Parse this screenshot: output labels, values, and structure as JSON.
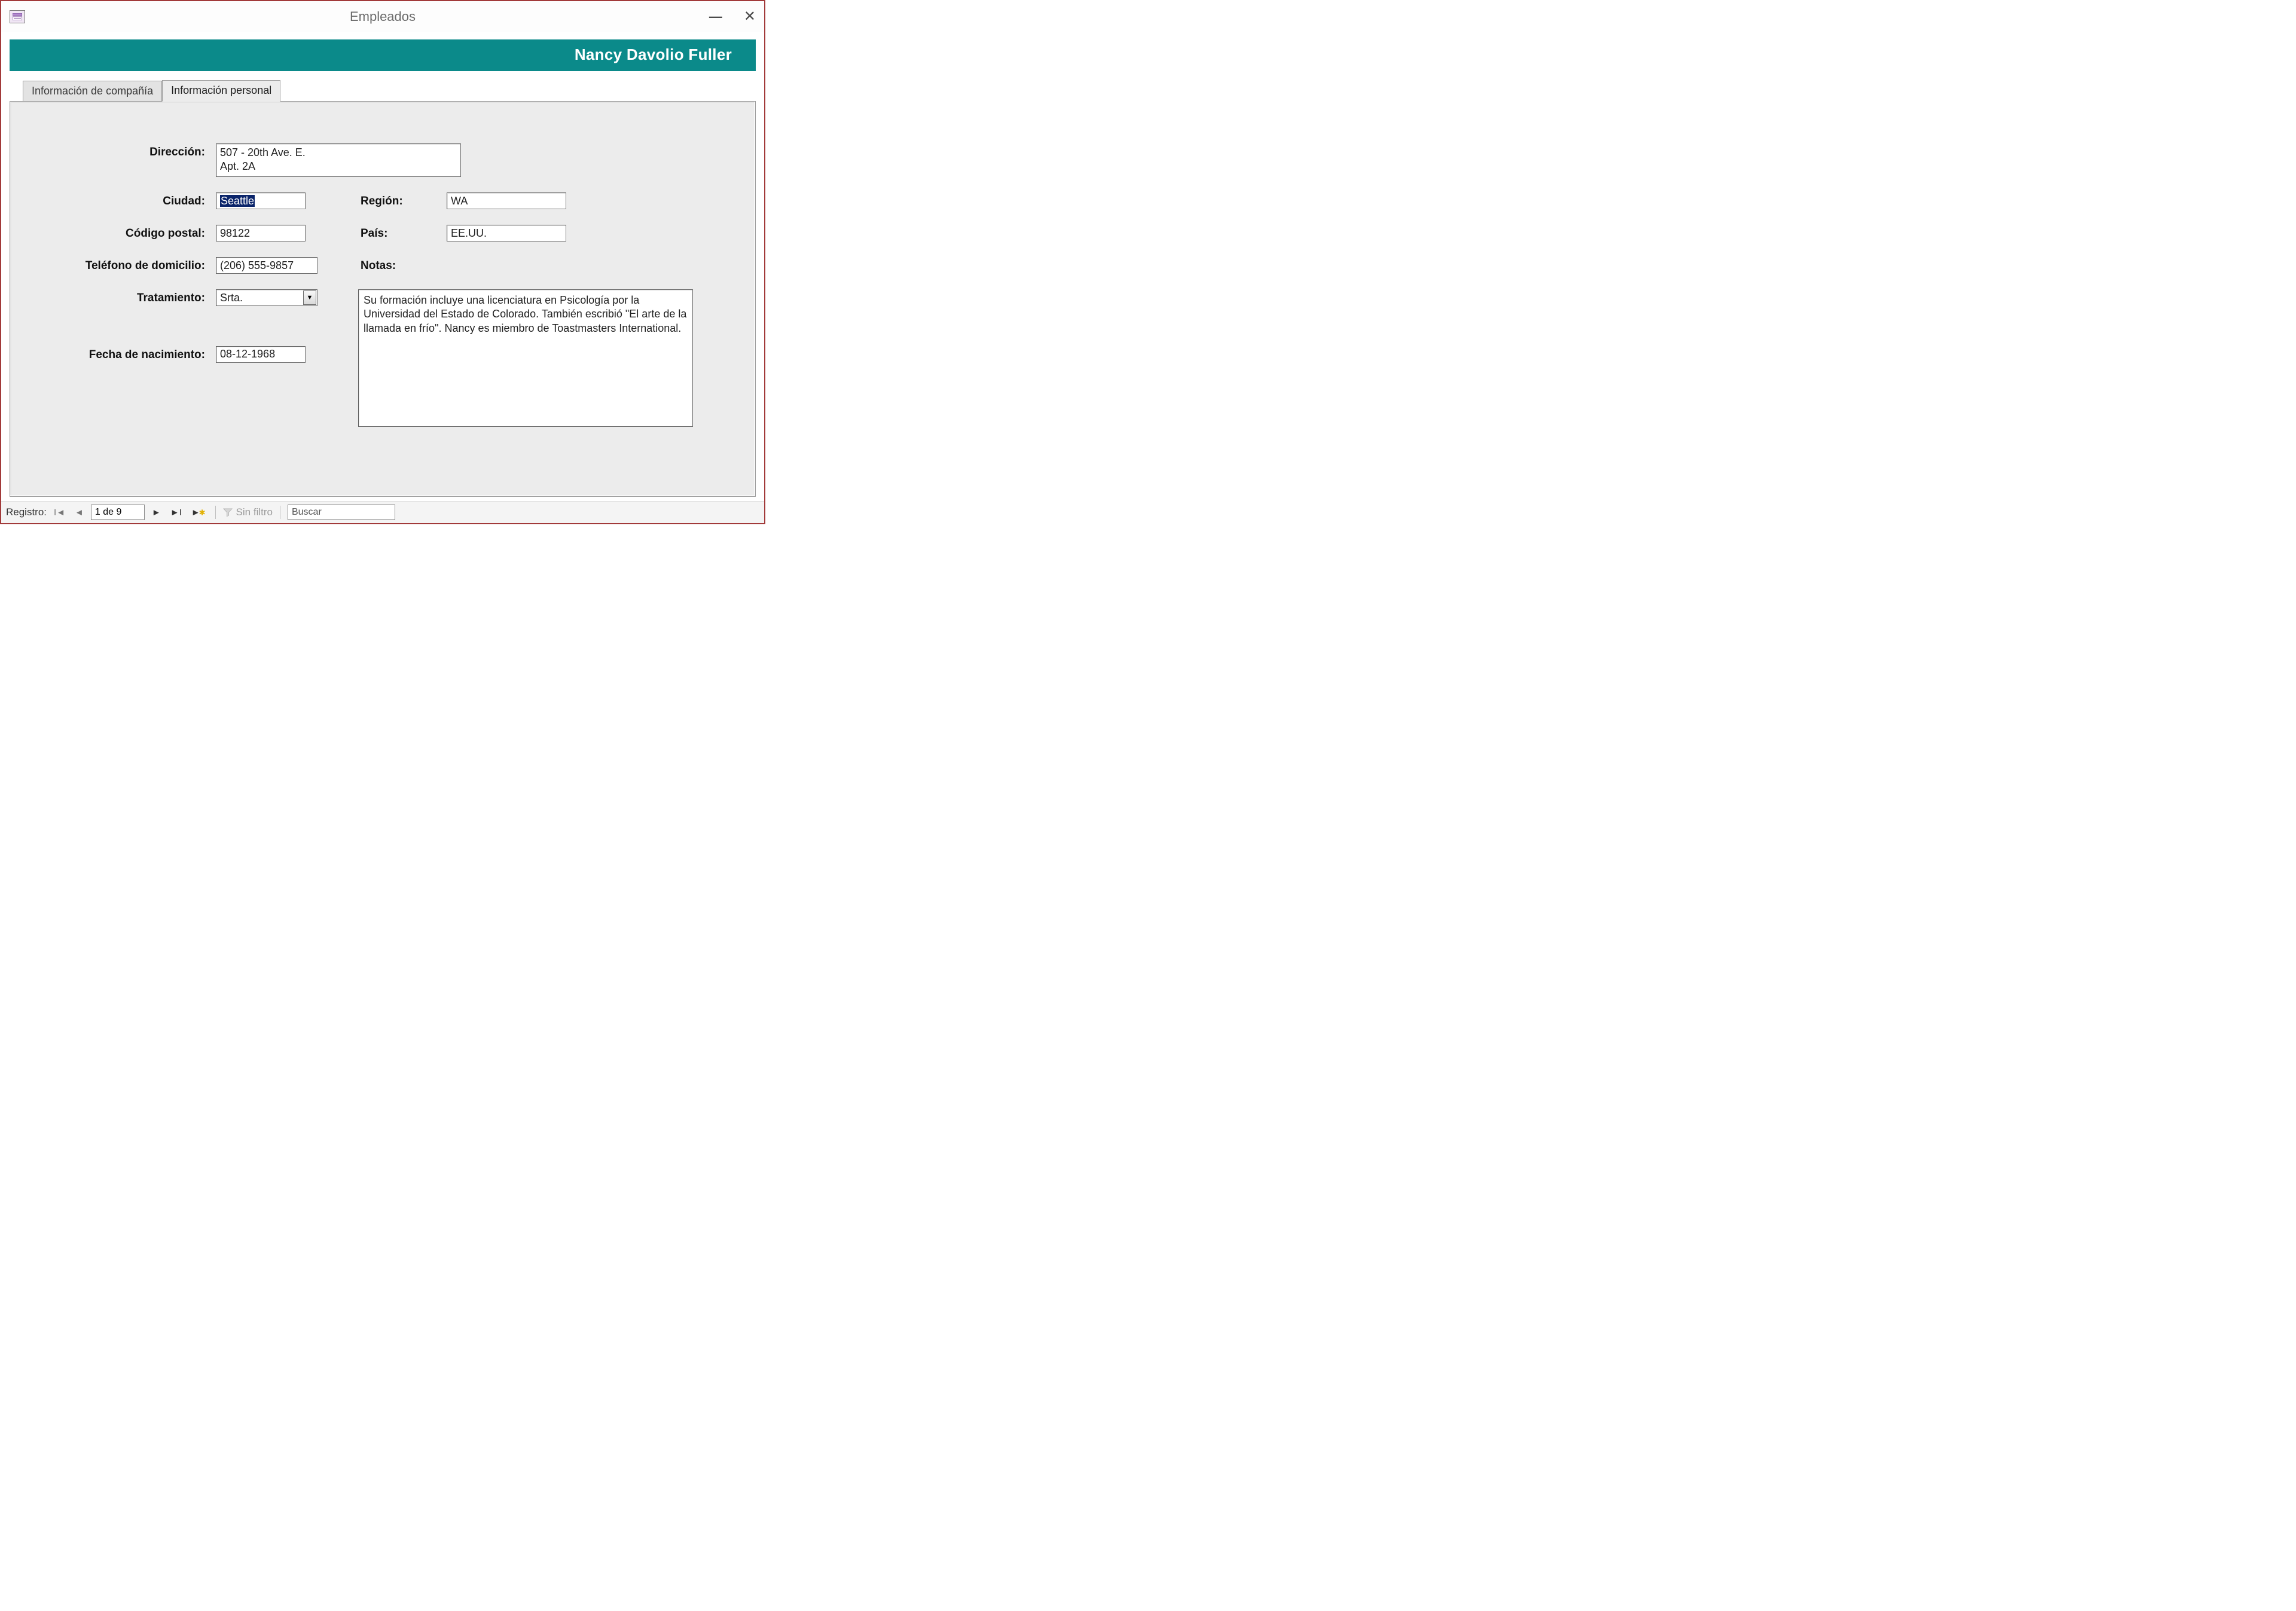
{
  "window": {
    "title": "Empleados"
  },
  "banner": {
    "person_name": "Nancy Davolio Fuller"
  },
  "tabs": {
    "company_label": "Información de compañía",
    "personal_label": "Información personal"
  },
  "labels": {
    "address": "Dirección:",
    "city": "Ciudad:",
    "region": "Región:",
    "postal": "Código postal:",
    "country": "País:",
    "home_phone": "Teléfono de domicilio:",
    "notes": "Notas:",
    "title_of_courtesy": "Tratamiento:",
    "birth_date": "Fecha de nacimiento:"
  },
  "fields": {
    "address": "507 - 20th Ave. E.\nApt. 2A",
    "city": "Seattle",
    "region": "WA",
    "postal": "98122",
    "country": "EE.UU.",
    "home_phone": "(206) 555-9857",
    "title_of_courtesy": "Srta.",
    "birth_date": "08-12-1968",
    "notes": "Su formación incluye una licenciatura en Psicología por la Universidad del Estado de Colorado. También escribió \"El arte de la llamada en frío\". Nancy es miembro de Toastmasters International."
  },
  "recordbar": {
    "label": "Registro:",
    "position": "1 de 9",
    "filter_label": "Sin filtro",
    "search_placeholder": "Buscar"
  }
}
